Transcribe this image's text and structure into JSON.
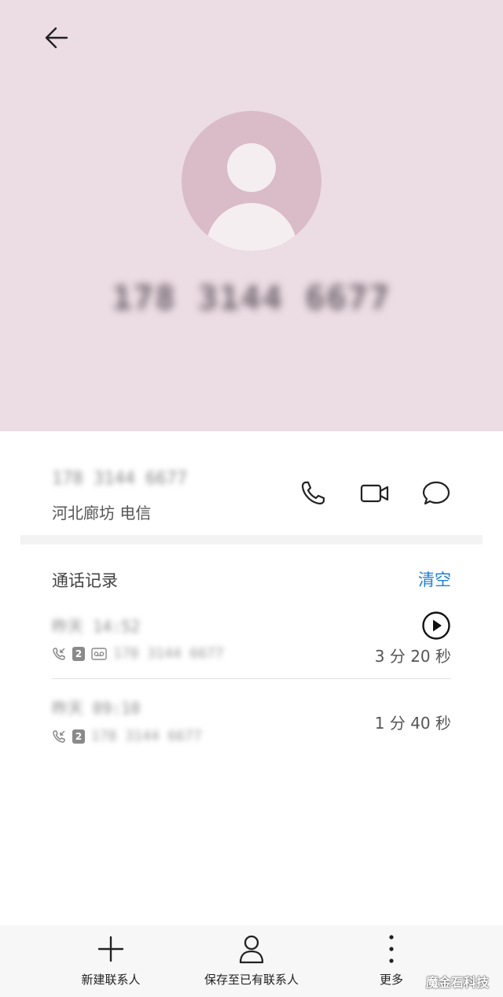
{
  "contact": {
    "phone_blurred": "178 3144 6677",
    "phone_row_blurred": "178 3144 6677",
    "location": "河北廊坊 电信"
  },
  "icons": {
    "back": "arrow-left-icon",
    "call": "phone-icon",
    "video": "video-camera-icon",
    "message": "chat-bubble-icon",
    "play": "play-icon",
    "incoming": "incoming-call-icon",
    "voicemail": "voicemail-icon"
  },
  "call_log": {
    "title": "通话记录",
    "clear_label": "清空",
    "records": [
      {
        "date_blurred": "昨天 14:52",
        "sim": "2",
        "detail_blurred": "178 3144 6677",
        "duration": "3 分 20 秒"
      },
      {
        "date_blurred": "昨天 09:10",
        "sim": "2",
        "detail_blurred": "178 3144 6677",
        "duration": "1 分 40 秒"
      }
    ]
  },
  "bottom_bar": {
    "new_contact": "新建联系人",
    "save_existing": "保存至已有联系人",
    "more": "更多"
  },
  "watermark": "魔金石科技",
  "colors": {
    "header_bg": "#ecdce4",
    "avatar_bg": "#d9bcc7",
    "accent": "#1e7fd6"
  }
}
